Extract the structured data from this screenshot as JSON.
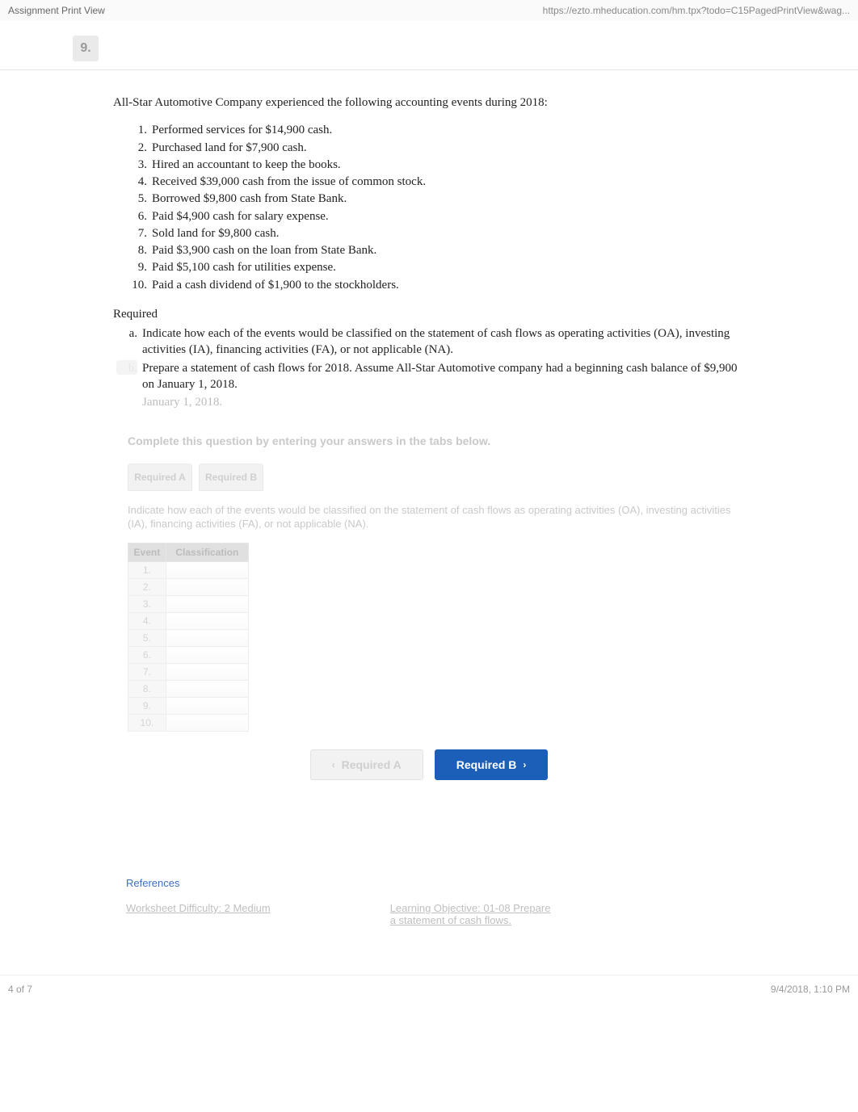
{
  "topbar": {
    "left": "Assignment Print View",
    "right": "https://ezto.mheducation.com/hm.tpx?todo=C15PagedPrintView&wag..."
  },
  "header": {
    "question_number": "9."
  },
  "problem": {
    "intro": "All-Star Automotive Company experienced the following accounting events during 2018:",
    "events": [
      {
        "num": "1.",
        "text": "Performed services for $14,900 cash."
      },
      {
        "num": "2.",
        "text": "Purchased land for $7,900 cash."
      },
      {
        "num": "3.",
        "text": "Hired an accountant to keep the books."
      },
      {
        "num": "4.",
        "text": "Received $39,000 cash from the issue of common stock."
      },
      {
        "num": "5.",
        "text": "Borrowed $9,800 cash from State Bank."
      },
      {
        "num": "6.",
        "text": "Paid $4,900 cash for salary expense."
      },
      {
        "num": "7.",
        "text": "Sold land for $9,800 cash."
      },
      {
        "num": "8.",
        "text": "Paid $3,900 cash on the loan from State Bank."
      },
      {
        "num": "9.",
        "text": "Paid $5,100 cash for utilities expense."
      },
      {
        "num": "10.",
        "text": " Paid a cash dividend of $1,900 to the stockholders."
      }
    ],
    "required_label": "Required",
    "required": [
      {
        "num": "a.",
        "text": "Indicate how each of the events would be classified on the statement of cash flows as operating activities (OA), investing activities (IA), financing activities (FA), or not applicable (NA)."
      },
      {
        "num": "b.",
        "text": "Prepare a statement of cash flows for 2018. Assume All-Star Automotive company had a beginning cash balance of $9,900 on January 1, 2018."
      }
    ],
    "sub_required_b_tail": "January 1, 2018."
  },
  "instruction": "Complete this question by entering your answers in the tabs below.",
  "tabs": {
    "a": "Required A",
    "b": "Required B"
  },
  "sub_instruction": "Indicate how each of the events would be classified on the statement of cash flows as operating activities (OA), investing activities (IA), financing activities (FA), or not applicable (NA).",
  "table": {
    "headers": {
      "event": "Event",
      "classification": "Classification"
    },
    "rows": [
      {
        "event": "1.",
        "classification": ""
      },
      {
        "event": "2.",
        "classification": ""
      },
      {
        "event": "3.",
        "classification": ""
      },
      {
        "event": "4.",
        "classification": ""
      },
      {
        "event": "5.",
        "classification": ""
      },
      {
        "event": "6.",
        "classification": ""
      },
      {
        "event": "7.",
        "classification": ""
      },
      {
        "event": "8.",
        "classification": ""
      },
      {
        "event": "9.",
        "classification": ""
      },
      {
        "event": "10.",
        "classification": ""
      }
    ]
  },
  "nav": {
    "prev": "Required A",
    "next": "Required B"
  },
  "footer": {
    "references": "References",
    "link1": "Worksheet Difficulty: 2 Medium",
    "link2_top": "Learning Objective: 01-08 Prepare",
    "link2_bot": "a statement of cash flows."
  },
  "pagefoot": {
    "left": "4 of 7",
    "right": "9/4/2018, 1:10 PM"
  }
}
